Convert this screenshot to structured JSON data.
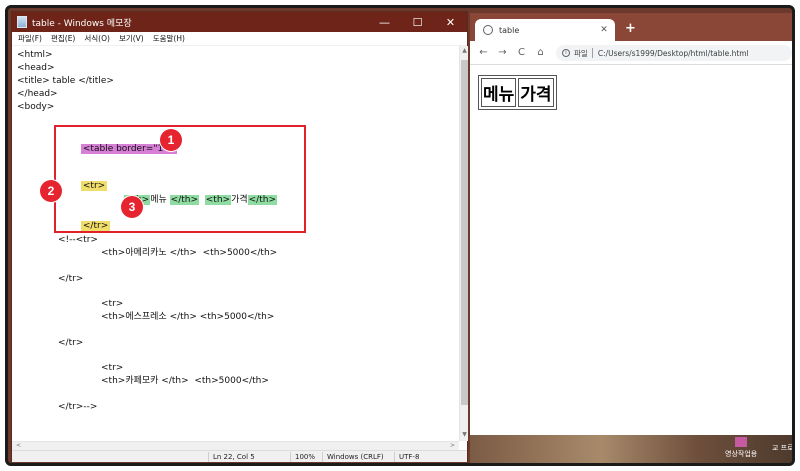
{
  "notepad": {
    "title": "table - Windows 메모장",
    "window_controls": {
      "minimize": "—",
      "maximize": "☐",
      "close": "✕"
    },
    "menu": [
      "파일(F)",
      "편집(E)",
      "서식(O)",
      "보기(V)",
      "도움말(H)"
    ],
    "lines": {
      "l1": "<html>",
      "l2": "<head>",
      "l3": "<title> table </title>",
      "l4": "</head>",
      "l5": "<body>",
      "table_open": "<table border=\"1\">",
      "tr_open": "<tr>",
      "th1_open": "<th>",
      "th1_text": "메뉴",
      "th1_close": "</th>",
      "th2_open": "<th>",
      "th2_text": "가격",
      "th2_close": "</th>",
      "tr_close": "</tr>",
      "c1": "<!--<tr>",
      "c2": "<th>아메리카노 </th>  <th>5000</th>",
      "c3": "</tr>",
      "c4": "<tr>",
      "c5": "<th>에스프레소 </th> <th>5000</th>",
      "c6": "</tr>",
      "c7": "<tr>",
      "c8": "<th>카페모카 </th>  <th>5000</th>",
      "c9": "</tr>-->"
    },
    "badges": [
      "1",
      "2",
      "3"
    ],
    "status": {
      "position": "Ln 22, Col 5",
      "zoom": "100%",
      "line_ending": "Windows (CRLF)",
      "encoding": "UTF-8"
    },
    "scroll_arrows": {
      "up": "▲",
      "down": "▼",
      "left": "<",
      "right": ">"
    }
  },
  "chrome": {
    "tab_title": "table",
    "tab_close": "✕",
    "new_tab": "+",
    "nav": {
      "back": "←",
      "forward": "→",
      "reload": "C",
      "home": "⌂"
    },
    "info": "i",
    "file_chip": "파일",
    "url": "C:/Users/s1999/Desktop/html/table.html",
    "table_headers": [
      "메뉴",
      "가격"
    ]
  },
  "desktop": {
    "icon_label": "영상작업용",
    "icon_label2": "교\n프로그"
  },
  "colors": {
    "highlight_purple": "#d77fd6",
    "highlight_yellow": "#f1de6a",
    "highlight_green": "#8fdca2",
    "annotation_red": "#e0202a",
    "notepad_titlebar": "#6e2418",
    "chrome_tabstrip": "#8a4636"
  }
}
